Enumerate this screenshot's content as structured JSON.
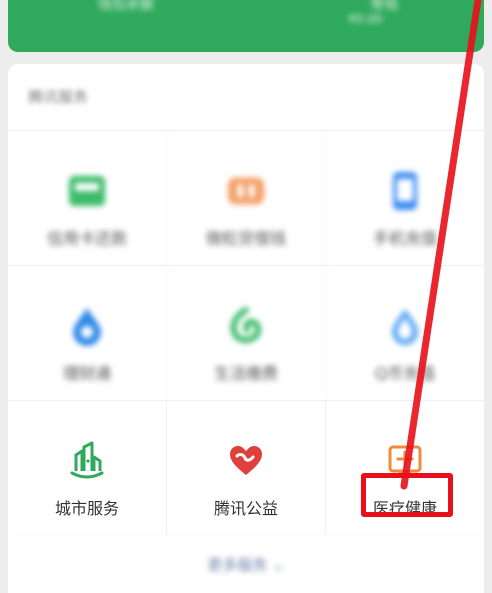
{
  "top_card": {
    "left_text": "钱包余额",
    "right_text": "零钱",
    "right_sub": "¥0.00"
  },
  "services": {
    "section_title": "腾讯服务",
    "rows": [
      [
        {
          "label": "信用卡还款",
          "icon": "credit-card-icon",
          "color": "#3dbb6b"
        },
        {
          "label": "微粒贷借钱",
          "icon": "loan-icon",
          "color": "#f08a3c"
        },
        {
          "label": "手机充值",
          "icon": "phone-icon",
          "color": "#3d8ef0"
        }
      ],
      [
        {
          "label": "理财通",
          "icon": "wealth-drop-icon",
          "color": "#2f89e8"
        },
        {
          "label": "生活缴费",
          "icon": "bill-icon",
          "color": "#3dbb6b"
        },
        {
          "label": "Q币充值",
          "icon": "qcoin-icon",
          "color": "#3d8ef0"
        }
      ],
      [
        {
          "label": "城市服务",
          "icon": "city-service-icon",
          "color": "#2faa5c"
        },
        {
          "label": "腾讯公益",
          "icon": "charity-heart-icon",
          "color": "#e0403c"
        },
        {
          "label": "医疗健康",
          "icon": "medical-cross-icon",
          "color": "#f08a3c"
        }
      ]
    ],
    "more_label": "更多服务 ⌄"
  },
  "colors": {
    "brand_green": "#2faa5c",
    "annotation_red": "#e8101a"
  }
}
